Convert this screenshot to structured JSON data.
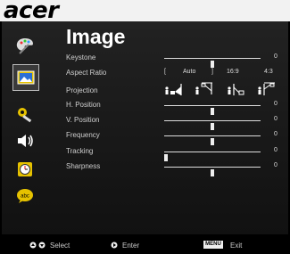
{
  "brand": {
    "logo": "acer"
  },
  "page": {
    "title": "Image"
  },
  "sidebar": {
    "items": [
      {
        "icon": "color-palette-icon"
      },
      {
        "icon": "image-icon",
        "active": true
      },
      {
        "icon": "settings-wrench-icon"
      },
      {
        "icon": "speaker-icon"
      },
      {
        "icon": "timer-icon"
      },
      {
        "icon": "language-icon"
      }
    ]
  },
  "settings": {
    "keystone": {
      "label": "Keystone",
      "value": "0",
      "level": 0.5
    },
    "aspect_ratio": {
      "label": "Aspect Ratio",
      "open_bracket": "[",
      "auto": "Auto",
      "close_bracket": "]",
      "ratio_16_9": "16:9",
      "ratio_4_3": "4:3"
    },
    "projection": {
      "label": "Projection"
    },
    "h_position": {
      "label": "H. Position",
      "value": "0",
      "level": 0.5
    },
    "v_position": {
      "label": "V. Position",
      "value": "0",
      "level": 0.5
    },
    "frequency": {
      "label": "Frequency",
      "value": "0",
      "level": 0.5
    },
    "tracking": {
      "label": "Tracking",
      "value": "0",
      "level": 0.0
    },
    "sharpness": {
      "label": "Sharpness",
      "value": "0",
      "level": 0.5
    }
  },
  "footer": {
    "select_label": "Select",
    "enter_label": "Enter",
    "menu_key": "MENU",
    "exit_label": "Exit"
  }
}
